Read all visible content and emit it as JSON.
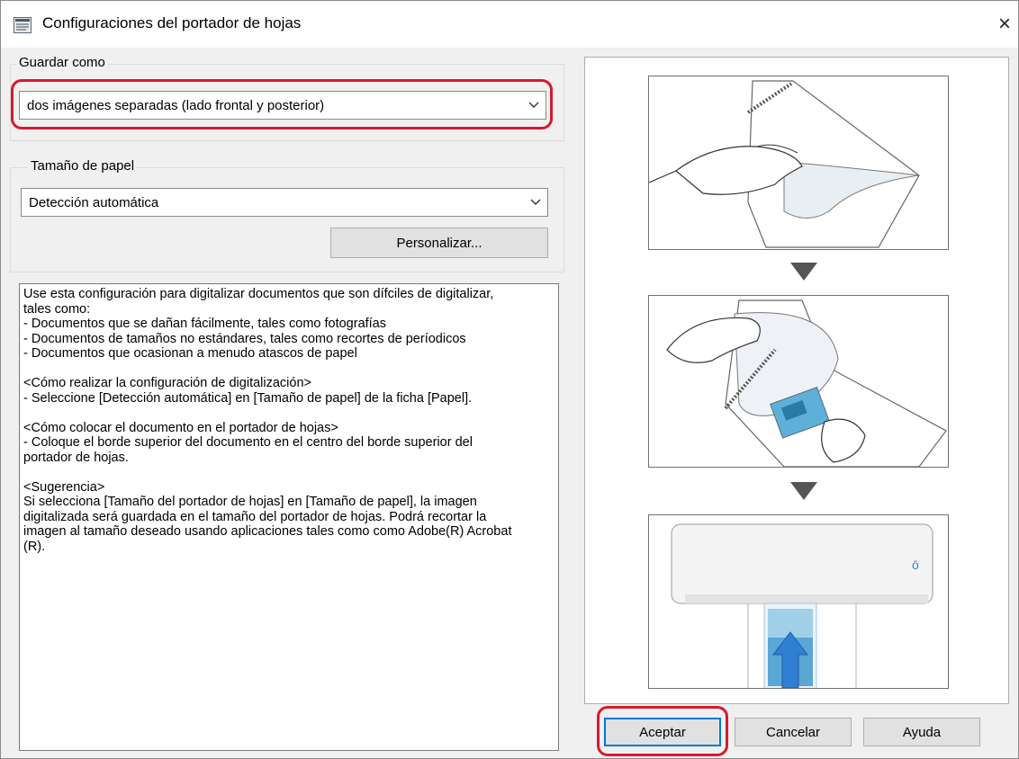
{
  "window": {
    "title": "Configuraciones del portador de hojas",
    "close_label": "×"
  },
  "save_as": {
    "legend": "Guardar como",
    "selected": "dos imágenes separadas (lado frontal y posterior)"
  },
  "paper_size": {
    "legend": "Tamaño de papel",
    "selected": "Detección automática",
    "customize_label": "Personalizar..."
  },
  "description": "Use esta configuración para digitalizar documentos que son dífciles de digitalizar,\ntales como:\n- Documentos que se dañan fácilmente, tales como fotografías\n- Documentos de tamaños no estándares, tales como recortes de períodicos\n- Documentos que ocasionan a menudo atascos de papel\n\n<Cómo realizar la configuración de digitalización>\n- Seleccione [Detección automática] en [Tamaño de papel] de la ficha [Papel].\n\n<Cómo colocar el documento en el portador de hojas>\n- Coloque el borde superior del documento en el centro del borde superior del\nportador de hojas.\n\n<Sugerencia>\nSi selecciona [Tamaño del portador de hojas] en [Tamaño de papel], la imagen\ndigitalizada será guardada en el tamaño del portador de hojas. Podrá recortar la\nimagen al tamaño deseado usando aplicaciones tales como como Adobe(R) Acrobat\n(R).",
  "buttons": {
    "ok": "Aceptar",
    "cancel": "Cancelar",
    "help": "Ayuda"
  },
  "icons": [
    "app-icon",
    "close-icon",
    "chevron-down-icon",
    "arrow-down-icon",
    "scanner-icon",
    "hand-icon",
    "photo-icon"
  ],
  "colors": {
    "highlight": "#d7192e",
    "focus": "#0078d7",
    "feed_arrow": "#2f7fd2"
  }
}
